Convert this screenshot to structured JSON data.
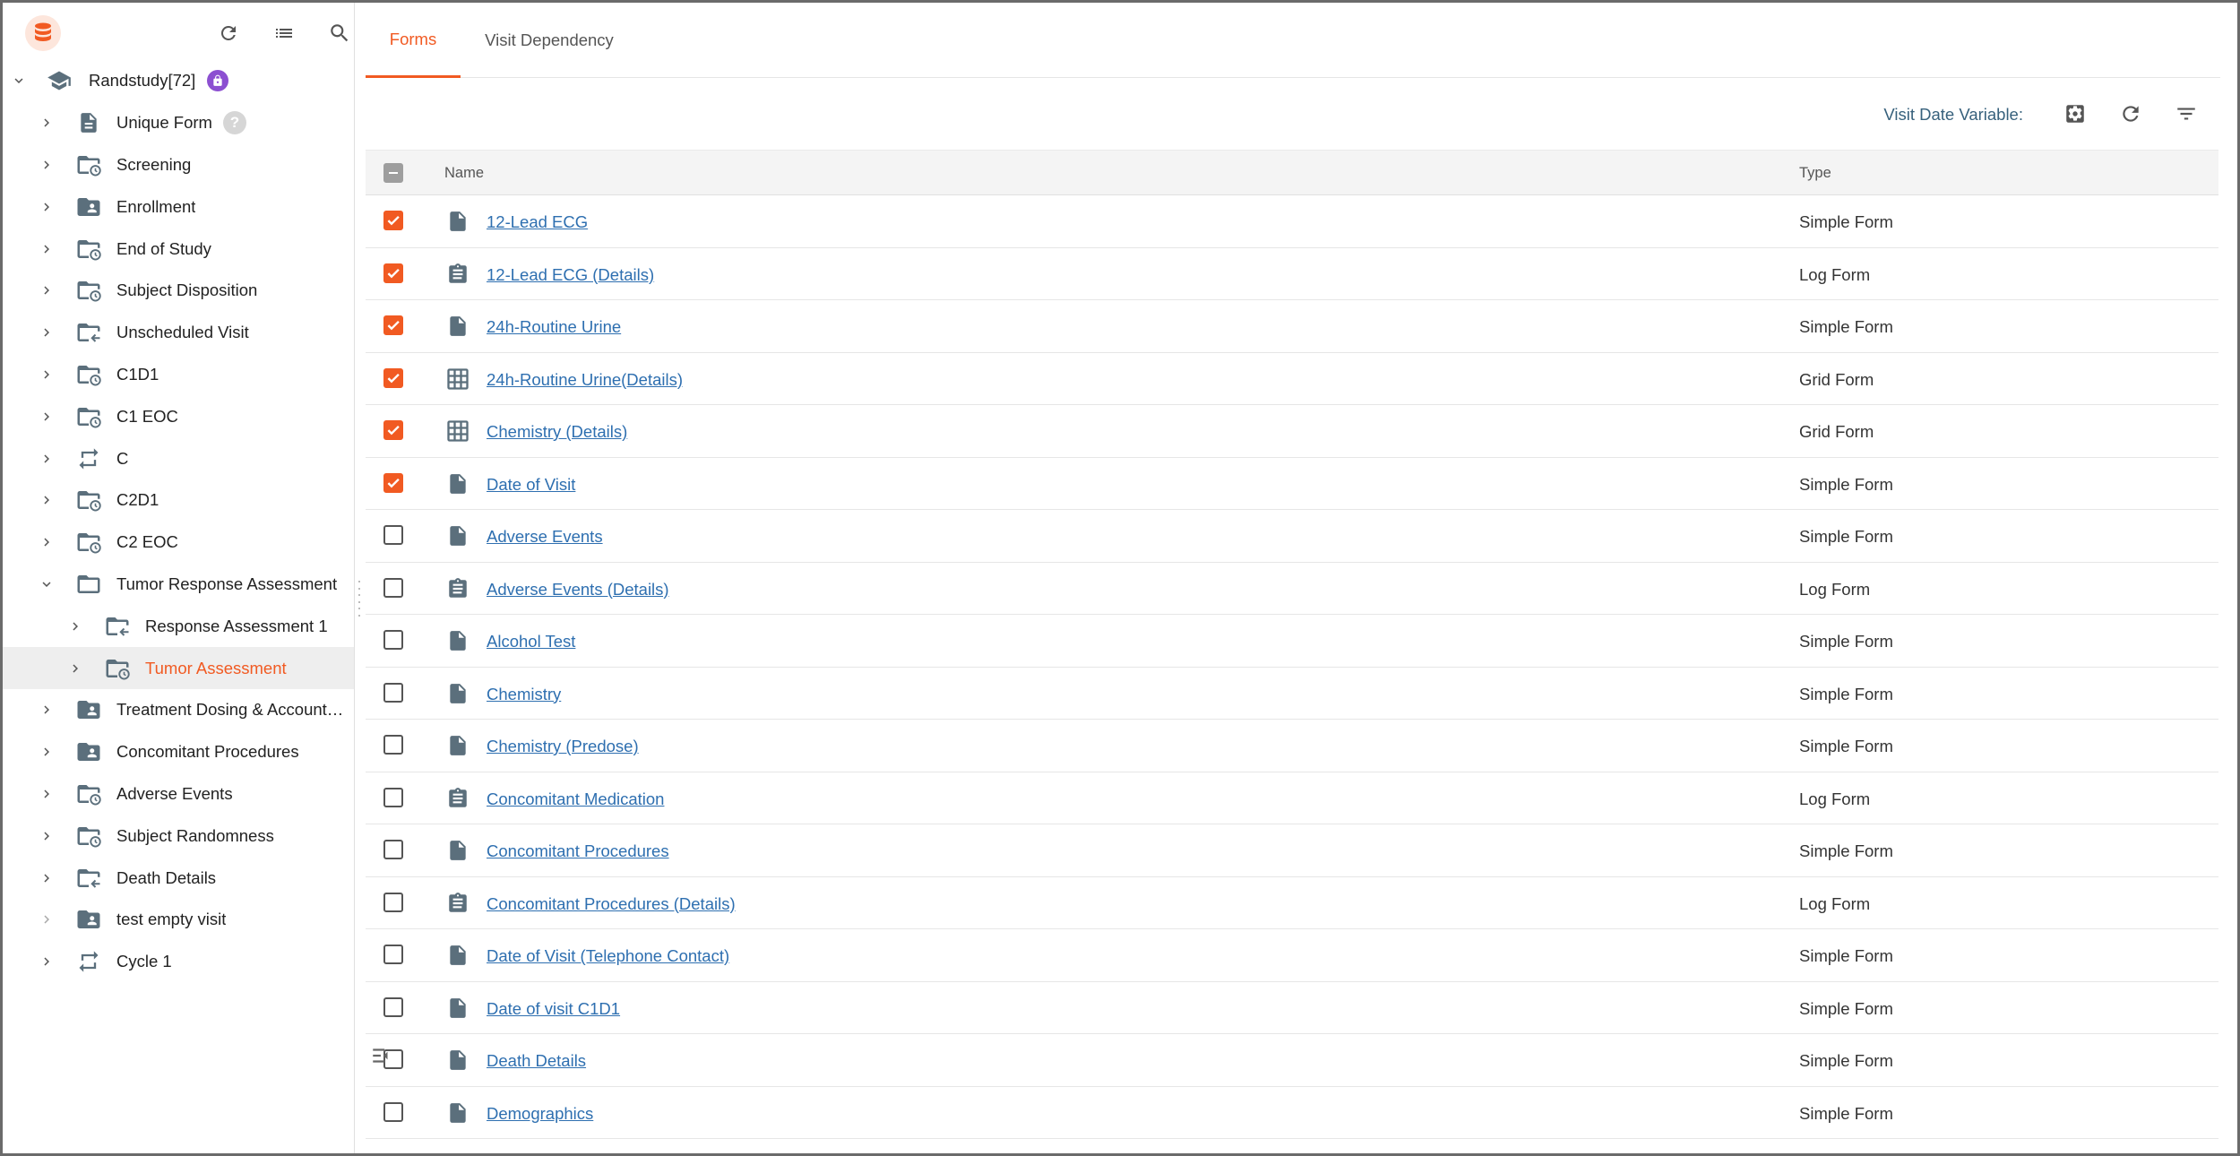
{
  "colors": {
    "accent": "#f15a22",
    "link": "#2e6fb0",
    "icon": "#5b6f7c",
    "lock_badge": "#8c4fd1",
    "header_label": "#37617c"
  },
  "sidebar": {
    "study": {
      "label": "Randstudy[72]",
      "icon": "school-icon",
      "badge": "lock-icon"
    },
    "items": [
      {
        "label": "Unique Form",
        "icon": "form-icon",
        "level": 1,
        "help": "?"
      },
      {
        "label": "Screening",
        "icon": "scheduled-folder-icon",
        "level": 1
      },
      {
        "label": "Enrollment",
        "icon": "person-folder-icon",
        "level": 1
      },
      {
        "label": "End of Study",
        "icon": "scheduled-folder-icon",
        "level": 1
      },
      {
        "label": "Subject Disposition",
        "icon": "scheduled-folder-icon",
        "level": 1
      },
      {
        "label": "Unscheduled Visit",
        "icon": "return-folder-icon",
        "level": 1
      },
      {
        "label": "C1D1",
        "icon": "scheduled-folder-icon",
        "level": 1
      },
      {
        "label": "C1 EOC",
        "icon": "scheduled-folder-icon",
        "level": 1
      },
      {
        "label": "C",
        "icon": "repeat-icon",
        "level": 1
      },
      {
        "label": "C2D1",
        "icon": "scheduled-folder-icon",
        "level": 1
      },
      {
        "label": "C2 EOC",
        "icon": "scheduled-folder-icon",
        "level": 1
      },
      {
        "label": "Tumor Response Assessment",
        "icon": "folder-icon",
        "level": 1,
        "expanded": true
      },
      {
        "label": "Response Assessment 1",
        "icon": "return-folder-icon",
        "level": 2
      },
      {
        "label": "Tumor Assessment",
        "icon": "scheduled-folder-icon",
        "level": 2,
        "selected": true
      },
      {
        "label": "Treatment Dosing & Accountability",
        "icon": "person-folder-icon",
        "level": 1
      },
      {
        "label": "Concomitant Procedures",
        "icon": "person-folder-icon",
        "level": 1
      },
      {
        "label": "Adverse Events",
        "icon": "scheduled-folder-icon",
        "level": 1
      },
      {
        "label": "Subject Randomness",
        "icon": "scheduled-folder-icon",
        "level": 1
      },
      {
        "label": "Death Details",
        "icon": "return-folder-icon",
        "level": 1
      },
      {
        "label": "test empty visit",
        "icon": "person-folder-icon",
        "level": 1,
        "dim_chevron": true
      },
      {
        "label": "Cycle 1",
        "icon": "repeat-icon",
        "level": 1
      }
    ]
  },
  "tabs": [
    {
      "label": "Forms",
      "active": true
    },
    {
      "label": "Visit Dependency",
      "active": false
    }
  ],
  "toolbar": {
    "visit_date_label": "Visit Date Variable:"
  },
  "table": {
    "columns": {
      "name": "Name",
      "type": "Type"
    },
    "rows": [
      {
        "name": "12-Lead ECG",
        "type": "Simple Form",
        "icon": "simple-form-icon",
        "checked": true
      },
      {
        "name": "12-Lead ECG (Details)",
        "type": "Log Form",
        "icon": "log-form-icon",
        "checked": true
      },
      {
        "name": "24h-Routine Urine",
        "type": "Simple Form",
        "icon": "simple-form-icon",
        "checked": true
      },
      {
        "name": "24h-Routine Urine(Details)",
        "type": "Grid Form",
        "icon": "grid-form-icon",
        "checked": true
      },
      {
        "name": "Chemistry (Details)",
        "type": "Grid Form",
        "icon": "grid-form-icon",
        "checked": true
      },
      {
        "name": "Date of Visit",
        "type": "Simple Form",
        "icon": "simple-form-icon",
        "checked": true
      },
      {
        "name": "Adverse Events",
        "type": "Simple Form",
        "icon": "simple-form-icon",
        "checked": false
      },
      {
        "name": "Adverse Events (Details)",
        "type": "Log Form",
        "icon": "log-form-icon",
        "checked": false
      },
      {
        "name": "Alcohol Test",
        "type": "Simple Form",
        "icon": "simple-form-icon",
        "checked": false
      },
      {
        "name": "Chemistry",
        "type": "Simple Form",
        "icon": "simple-form-icon",
        "checked": false
      },
      {
        "name": "Chemistry (Predose)",
        "type": "Simple Form",
        "icon": "simple-form-icon",
        "checked": false
      },
      {
        "name": "Concomitant Medication",
        "type": "Log Form",
        "icon": "log-form-icon",
        "checked": false
      },
      {
        "name": "Concomitant Procedures",
        "type": "Simple Form",
        "icon": "simple-form-icon",
        "checked": false
      },
      {
        "name": "Concomitant Procedures (Details)",
        "type": "Log Form",
        "icon": "log-form-icon",
        "checked": false
      },
      {
        "name": "Date of Visit (Telephone Contact)",
        "type": "Simple Form",
        "icon": "simple-form-icon",
        "checked": false
      },
      {
        "name": "Date of visit C1D1",
        "type": "Simple Form",
        "icon": "simple-form-icon",
        "checked": false
      },
      {
        "name": "Death Details",
        "type": "Simple Form",
        "icon": "simple-form-icon",
        "checked": false
      },
      {
        "name": "Demographics",
        "type": "Simple Form",
        "icon": "simple-form-icon",
        "checked": false
      }
    ]
  }
}
